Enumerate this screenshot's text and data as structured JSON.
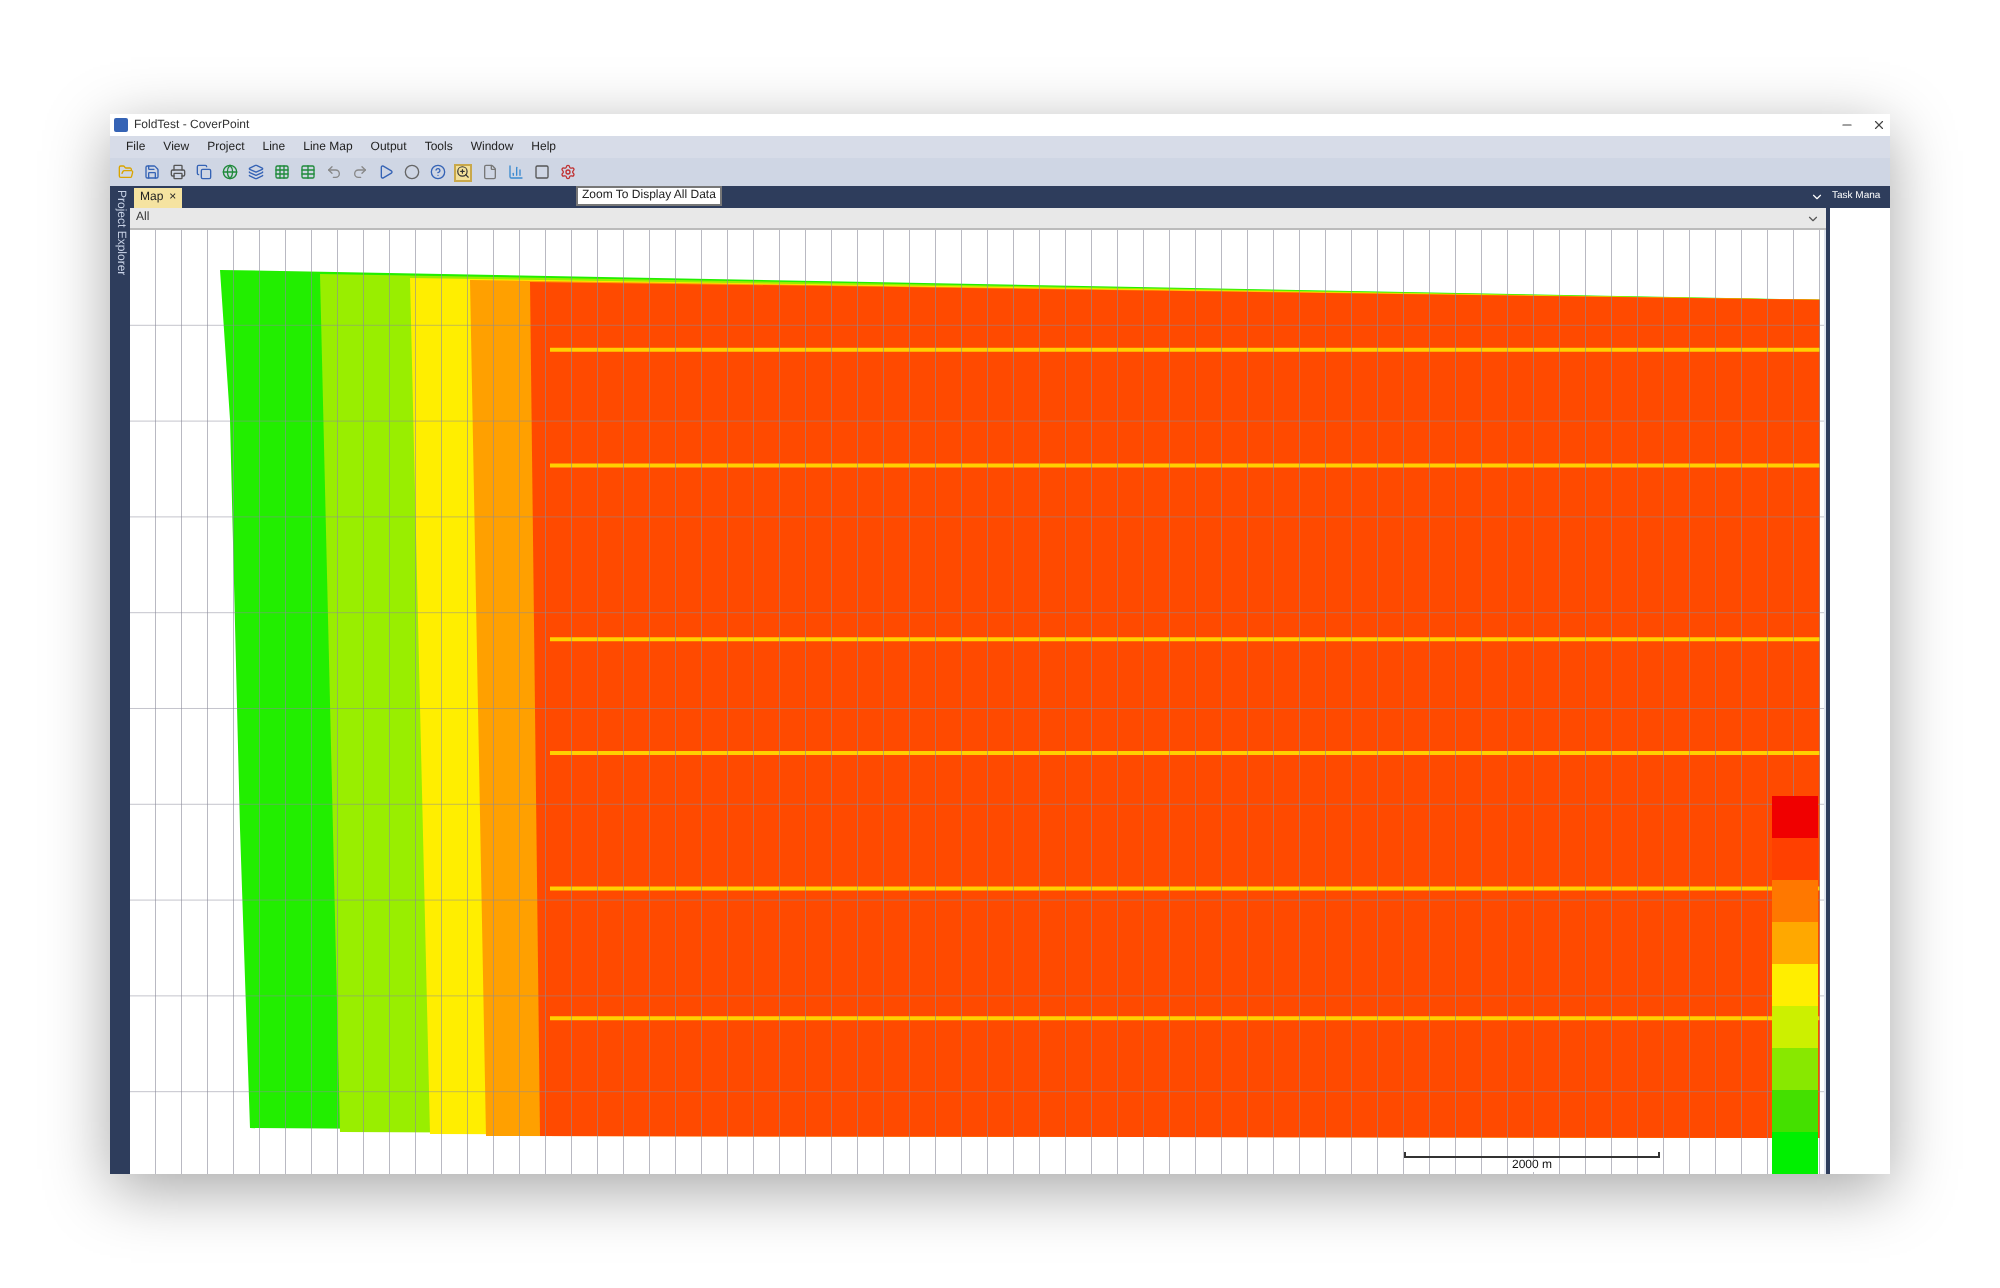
{
  "window": {
    "title": "FoldTest - CoverPoint"
  },
  "menu": [
    {
      "label": "File"
    },
    {
      "label": "View"
    },
    {
      "label": "Project"
    },
    {
      "label": "Line"
    },
    {
      "label": "Line Map"
    },
    {
      "label": "Output"
    },
    {
      "label": "Tools"
    },
    {
      "label": "Window"
    },
    {
      "label": "Help"
    }
  ],
  "tooltip": "Zoom To Display All Data",
  "side_panel": {
    "title": "Project Explorer"
  },
  "tabs": [
    {
      "label": "Map",
      "close": "×",
      "selected": true
    }
  ],
  "task_panel": {
    "title": "Task Mana"
  },
  "layer_select": {
    "value": "All"
  },
  "map": {
    "kind": "picture",
    "scale_bar": "2000 m",
    "legend": [
      {
        "color": "#f00000"
      },
      {
        "color": "#ff4000"
      },
      {
        "color": "#ff7800"
      },
      {
        "color": "#ffa800"
      },
      {
        "color": "#ffee00"
      },
      {
        "color": "#ccf000"
      },
      {
        "color": "#88e800"
      },
      {
        "color": "#44e000"
      },
      {
        "color": "#00f000"
      }
    ]
  }
}
